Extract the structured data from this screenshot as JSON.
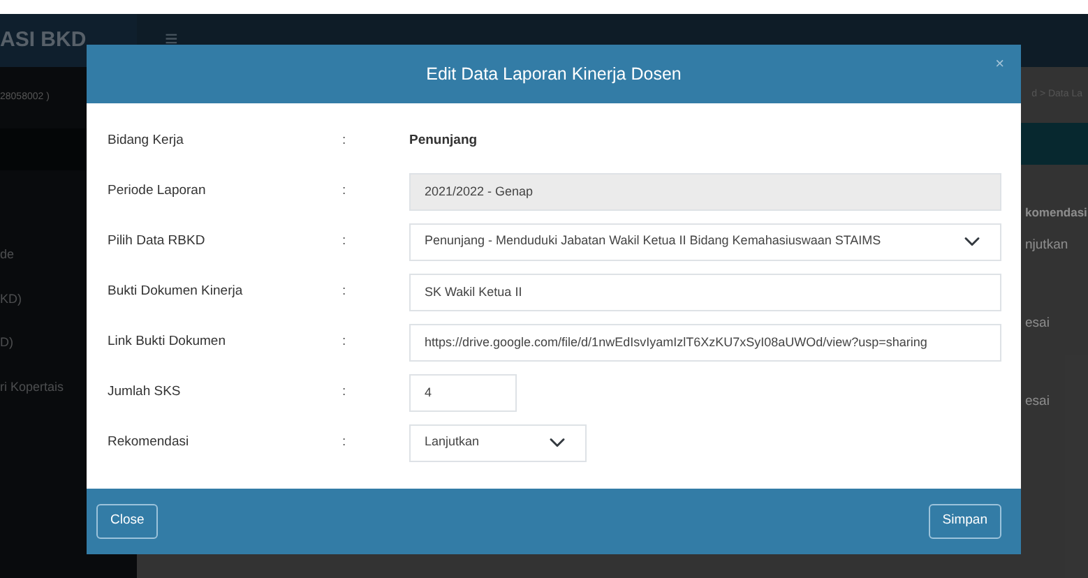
{
  "background": {
    "brand": "ASI BKD",
    "menu_icon": "≡",
    "user_id": "28058002 )",
    "sidebar_items": [
      "de",
      "KD)",
      "D)",
      "ri Kopertais"
    ],
    "breadcrumb": "d  >  Data La",
    "column_header": "komendasi",
    "cells": [
      "njutkan",
      "esai",
      "esai"
    ]
  },
  "modal": {
    "title": "Edit Data Laporan Kinerja Dosen",
    "close_icon": "×",
    "fields": [
      {
        "kind": "static",
        "label": "Bidang Kerja",
        "separator": ":",
        "value": "Penunjang"
      },
      {
        "kind": "readonly",
        "label": "Periode Laporan",
        "separator": ":",
        "value": "2021/2022 - Genap"
      },
      {
        "kind": "select",
        "label": "Pilih Data RBKD",
        "separator": ":",
        "value": "Penunjang - Menduduki Jabatan Wakil Ketua II Bidang Kemahasiuswaan STAIMS"
      },
      {
        "kind": "text",
        "label": "Bukti Dokumen Kinerja",
        "separator": ":",
        "value": "SK Wakil Ketua II"
      },
      {
        "kind": "text",
        "label": "Link Bukti Dokumen",
        "separator": ":",
        "value": "https://drive.google.com/file/d/1nwEdIsvIyamIzlT6XzKU7xSyI08aUWOd/view?usp=sharing"
      },
      {
        "kind": "number",
        "label": "Jumlah SKS",
        "separator": ":",
        "value": "4"
      },
      {
        "kind": "select-short",
        "label": "Rekomendasi",
        "separator": ":",
        "value": "Lanjutkan"
      }
    ],
    "buttons": [
      "Close",
      "Simpan"
    ]
  }
}
